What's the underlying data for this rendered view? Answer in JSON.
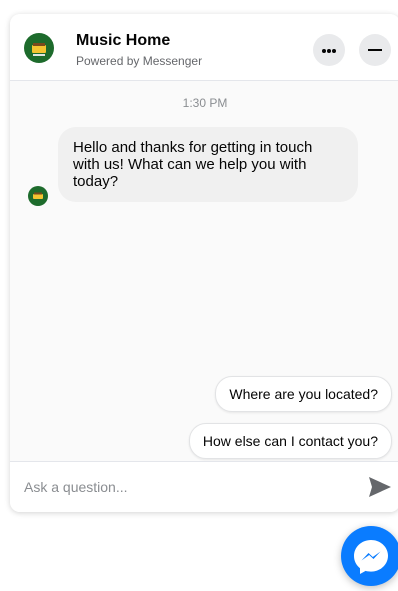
{
  "header": {
    "title": "Music Home",
    "subtitle": "Powered by Messenger",
    "avatar_icon": "music-home-logo-icon",
    "more_icon": "more-options-icon",
    "minimize_icon": "minimize-icon"
  },
  "conversation": {
    "timestamp": "1:30 PM",
    "messages": [
      {
        "sender": "Music Home",
        "text": "Hello and thanks for getting in touch with us! What can we help you with today?"
      }
    ],
    "quick_replies": [
      "Where are you located?",
      "How else can I contact you?"
    ]
  },
  "composer": {
    "placeholder": "Ask a question...",
    "send_icon": "send-icon"
  },
  "launcher": {
    "icon": "messenger-icon",
    "color": "#0a7cff"
  },
  "colors": {
    "brand": "#1d6b2c",
    "accent": "#0a7cff",
    "bubble": "#f0f0f0"
  }
}
